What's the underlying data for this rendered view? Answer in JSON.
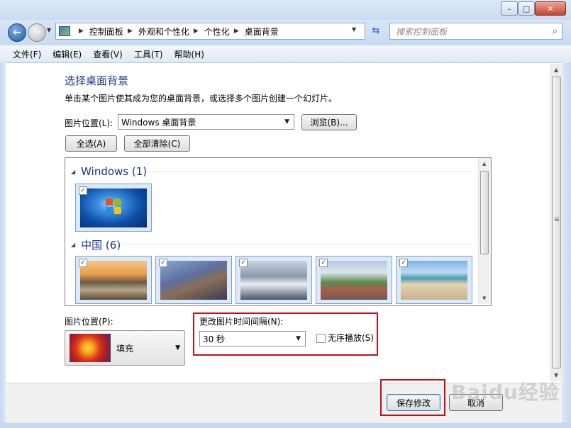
{
  "window": {
    "min_icon": "minimize-icon",
    "max_icon": "maximize-icon",
    "close_icon": "close-icon"
  },
  "address": {
    "crumbs": [
      "控制面板",
      "外观和个性化",
      "个性化",
      "桌面背景"
    ],
    "search_placeholder": "搜索控制面板"
  },
  "menu": [
    "文件(F)",
    "编辑(E)",
    "查看(V)",
    "工具(T)",
    "帮助(H)"
  ],
  "main": {
    "title": "选择桌面背景",
    "description": "单击某个图片使其成为您的桌面背景，或选择多个图片创建一个幻灯片。",
    "location_label": "图片位置(L):",
    "location_value": "Windows 桌面背景",
    "browse_button": "浏览(B)...",
    "select_all_button": "全选(A)",
    "clear_all_button": "全部清除(C)"
  },
  "groups": [
    {
      "name": "Windows (1)",
      "count": 1
    },
    {
      "name": "中国 (6)",
      "count": 6
    }
  ],
  "position": {
    "label": "图片位置(P):",
    "value": "填充"
  },
  "interval": {
    "label": "更改图片时间间隔(N):",
    "value": "30 秒"
  },
  "shuffle": {
    "label": "无序播放(S)",
    "checked": false
  },
  "buttons": {
    "save": "保存修改",
    "cancel": "取消"
  },
  "watermark": "Baidu经验",
  "colors": {
    "accent_red": "#c0101a",
    "title_blue": "#1e3287",
    "heading_blue": "#1e3a8a"
  }
}
